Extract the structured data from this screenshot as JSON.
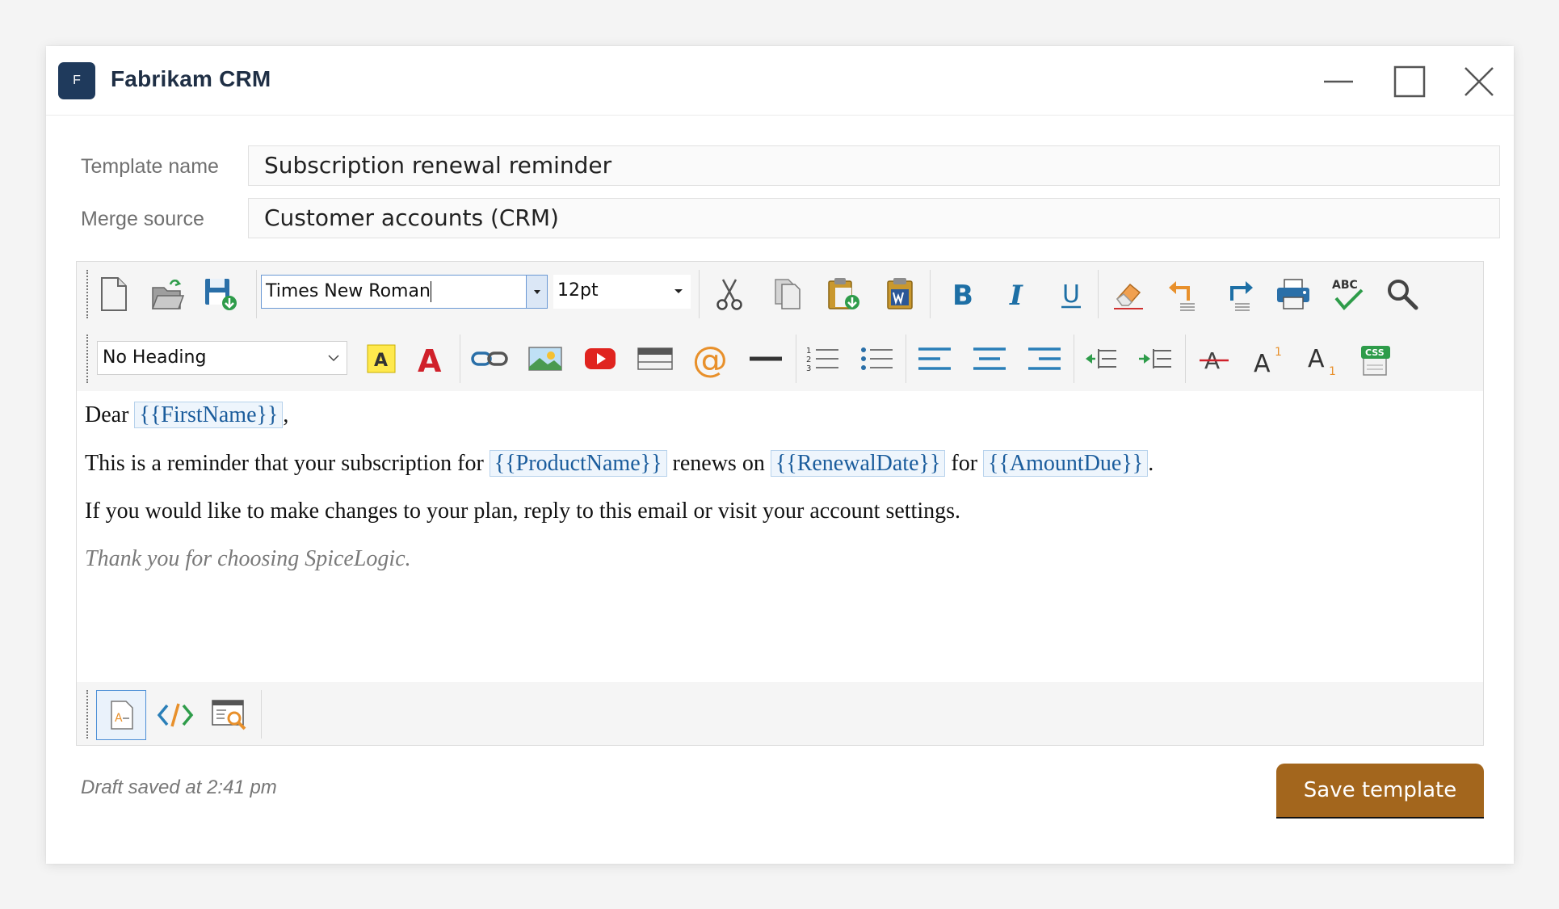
{
  "window": {
    "logo_letter": "F",
    "title": "Fabrikam CRM"
  },
  "form": {
    "template_name_label": "Template name",
    "template_name_value": "Subscription renewal reminder",
    "merge_source_label": "Merge source",
    "merge_source_value": "Customer accounts (CRM)"
  },
  "toolbar": {
    "font_family": "Times New Roman",
    "font_size": "12pt",
    "heading": "No Heading",
    "superscript_label": "A",
    "superscript_mark": "1",
    "subscript_label": "A",
    "subscript_mark": "1",
    "highlight_label": "A",
    "font_color_label": "A",
    "spellcheck_label": "ABC",
    "css_label": "CSS"
  },
  "body": {
    "greeting_prefix": "Dear",
    "first_name_tag": "{{FirstName}}",
    "greeting_suffix": ",",
    "line2_part1": "This is a reminder that your subscription for",
    "product_tag": "{{ProductName}}",
    "line2_part2": "renews on",
    "renewal_tag": "{{RenewalDate}}",
    "line2_part3": "for",
    "amount_tag": "{{AmountDue}}",
    "line2_end": ".",
    "line3": "If you would like to make changes to your plan, reply to this email or visit your account settings.",
    "closing": "Thank you for choosing SpiceLogic."
  },
  "footer": {
    "status": "Draft saved at 2:41 pm",
    "save_label": "Save template"
  },
  "colors": {
    "accent": "#a3661d",
    "tag_text": "#1a5c9c",
    "logo_bg": "#1f3a5c",
    "icon_blue": "#1d6fa5",
    "icon_red": "#d0202a",
    "icon_orange": "#e8902b"
  }
}
